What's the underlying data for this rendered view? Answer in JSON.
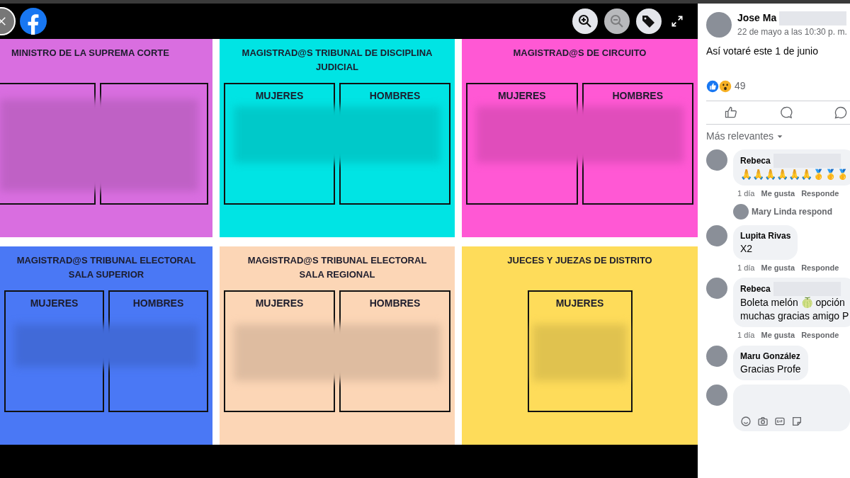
{
  "viewer": {
    "tools": [
      {
        "kind": "zoom-in",
        "disabled": false
      },
      {
        "kind": "zoom-out",
        "disabled": true
      },
      {
        "kind": "tag",
        "disabled": false
      },
      {
        "kind": "fullscreen",
        "disabled": false
      }
    ]
  },
  "ballot_panels": [
    {
      "title": [
        "MINISTRO DE LA SUPREMA CORTE"
      ],
      "color": "#d96ee0",
      "boxes": [
        {
          "kind": "blank"
        },
        {
          "kind": "blank"
        }
      ]
    },
    {
      "title": [
        "MAGISTRAD@S TRIBUNAL DE DISCIPLINA JUDICIAL"
      ],
      "color": "#00e4e4",
      "boxes": [
        {
          "kind": "labeled",
          "label": "MUJERES"
        },
        {
          "kind": "labeled",
          "label": "HOMBRES"
        }
      ]
    },
    {
      "title": [
        "MAGISTRAD@S DE CIRCUITO"
      ],
      "color": "#ff58d4",
      "boxes": [
        {
          "kind": "labeled",
          "label": "MUJERES"
        },
        {
          "kind": "labeled",
          "label": "HOMBRES"
        }
      ]
    },
    {
      "title": [
        "MAGISTRAD@S TRIBUNAL ELECTORAL",
        "SALA SUPERIOR"
      ],
      "color": "#4a78f5",
      "boxes": [
        {
          "kind": "labeled",
          "label": "MUJERES"
        },
        {
          "kind": "labeled",
          "label": "HOMBRES"
        }
      ]
    },
    {
      "title": [
        "MAGISTRAD@S TRIBUNAL ELECTORAL",
        "SALA REGIONAL"
      ],
      "color": "#fcd6b6",
      "boxes": [
        {
          "kind": "labeled",
          "label": "MUJERES"
        },
        {
          "kind": "labeled",
          "label": "HOMBRES"
        }
      ]
    },
    {
      "title": [
        "JUECES Y JUEZAS DE DISTRITO"
      ],
      "color": "#fedc5a",
      "boxes": [
        {
          "kind": "labeled",
          "label": "MUJERES"
        }
      ]
    }
  ],
  "post": {
    "author": "Jose Ma",
    "date": "22 de mayo a las 10:30 p. m.",
    "text": "Así votaré este 1 de junio",
    "reaction_count": "49",
    "sort": "Más relevantes"
  },
  "comments": [
    {
      "kind": "comment",
      "author": "Rebeca",
      "name_hidden": true,
      "lines": [
        "🙏🙏🙏🙏🙏🙏🥇🥇🥇"
      ],
      "actions": [
        "1 día",
        "Me gusta",
        "Responde"
      ]
    },
    {
      "kind": "reply",
      "text": "Mary Linda respond"
    },
    {
      "kind": "comment",
      "author": "Lupita Rivas",
      "name_hidden": false,
      "lines": [
        "X2"
      ],
      "actions": [
        "1 día",
        "Me gusta",
        "Responde"
      ]
    },
    {
      "kind": "comment",
      "author": "Rebeca",
      "name_hidden": true,
      "lines": [
        "Boleta melón 🍈 opción",
        "muchas gracias amigo P"
      ],
      "actions": [
        "1 día",
        "Me gusta",
        "Responde"
      ]
    },
    {
      "kind": "comment",
      "author": "Maru González",
      "name_hidden": false,
      "lines": [
        "Gracias Profe"
      ]
    }
  ]
}
